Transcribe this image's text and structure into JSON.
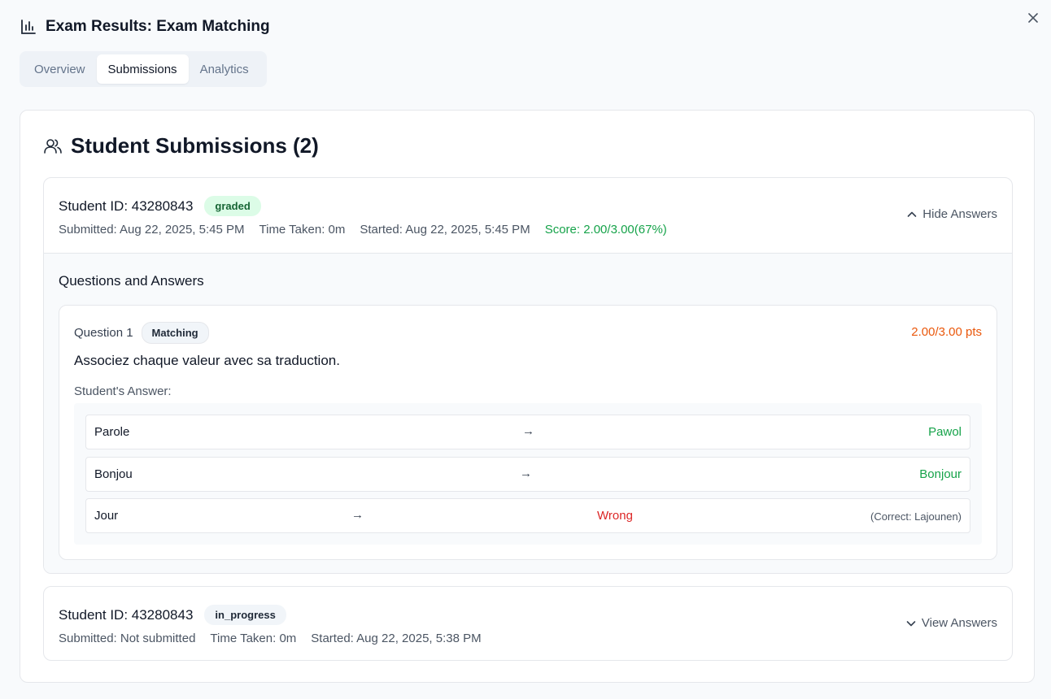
{
  "header": {
    "title": "Exam Results: Exam Matching"
  },
  "tabs": [
    {
      "label": "Overview"
    },
    {
      "label": "Submissions"
    },
    {
      "label": "Analytics"
    }
  ],
  "active_tab": "Submissions",
  "card": {
    "title": "Student Submissions (2)"
  },
  "submissions": [
    {
      "student_id": "Student ID: 43280843",
      "status": "graded",
      "submitted": "Submitted: Aug 22, 2025, 5:45 PM",
      "time_taken": "Time Taken: 0m",
      "started": "Started: Aug 22, 2025, 5:45 PM",
      "score": "Score: 2.00/3.00(67%)",
      "toggle_label": "Hide Answers",
      "qa_title": "Questions and Answers",
      "questions": [
        {
          "number": "Question 1",
          "type": "Matching",
          "points": "2.00/3.00 pts",
          "text": "Associez chaque valeur avec sa traduction.",
          "answer_label": "Student's Answer:",
          "pairs": [
            {
              "left": "Parole",
              "arrow": "→",
              "right": "Pawol",
              "correct": true
            },
            {
              "left": "Bonjou",
              "arrow": "→",
              "right": "Bonjour",
              "correct": true
            },
            {
              "left": "Jour",
              "arrow": "→",
              "right": "Wrong",
              "correct": false,
              "correction": "(Correct: Lajounen)"
            }
          ]
        }
      ]
    },
    {
      "student_id": "Student ID: 43280843",
      "status": "in_progress",
      "submitted": "Submitted: Not submitted",
      "time_taken": "Time Taken: 0m",
      "started": "Started: Aug 22, 2025, 5:38 PM",
      "toggle_label": "View Answers"
    }
  ],
  "colors": {
    "score_green": "#16a34a",
    "points_orange": "#ea580c",
    "wrong_red": "#dc2626",
    "graded_badge_bg": "#dcfce7"
  },
  "icons": [
    "bar-chart-icon",
    "close-icon",
    "users-icon",
    "chevron-up-icon",
    "chevron-down-icon"
  ]
}
